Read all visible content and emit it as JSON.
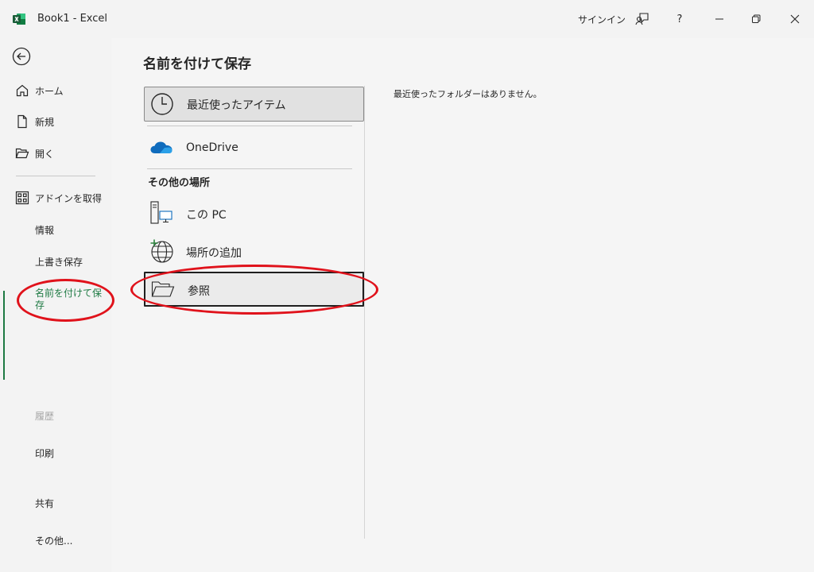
{
  "window": {
    "title": "Book1  -  Excel",
    "signin_label": "サインイン",
    "help_label": "?"
  },
  "nav": {
    "items": [
      {
        "label": "ホーム",
        "icon": "home-icon"
      },
      {
        "label": "新規",
        "icon": "new-document-icon"
      },
      {
        "label": "開く",
        "icon": "open-folder-icon"
      },
      {
        "label": "アドインを取得",
        "icon": "addins-grid-icon"
      },
      {
        "label": "情報"
      },
      {
        "label": "上書き保存"
      },
      {
        "label": "名前を付けて保存",
        "active": true
      },
      {
        "label": "履歴",
        "disabled": true
      },
      {
        "label": "印刷"
      },
      {
        "label": "共有"
      },
      {
        "label": "その他..."
      }
    ]
  },
  "main": {
    "title": "名前を付けて保存",
    "locations": {
      "recent": "最近使ったアイテム",
      "onedrive": "OneDrive",
      "other_heading": "その他の場所",
      "this_pc": "この PC",
      "add_place": "場所の追加",
      "browse": "参照"
    },
    "empty_message": "最近使ったフォルダーはありません。"
  },
  "colors": {
    "accent_green": "#1e7a43",
    "annotation_red": "#e0121b",
    "onedrive_blue": "#0f6cbd"
  }
}
